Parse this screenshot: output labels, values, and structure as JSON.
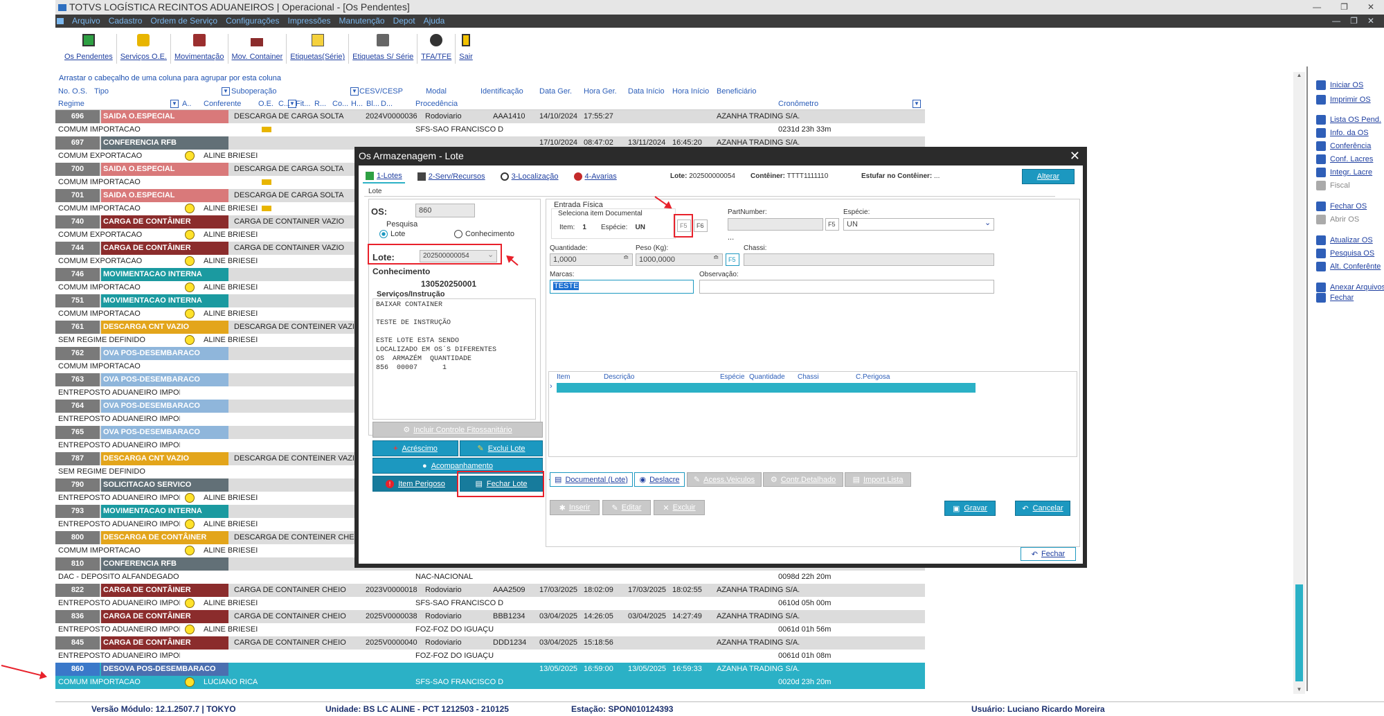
{
  "window": {
    "title": "TOTVS LOGÍSTICA RECINTOS ADUANEIROS | Operacional - [Os Pendentes]"
  },
  "menu": [
    "Arquivo",
    "Cadastro",
    "Ordem de Serviço",
    "Configurações",
    "Impressões",
    "Manutenção",
    "Depot",
    "Ajuda"
  ],
  "toolbar": [
    "Os Pendentes",
    "Serviços O.E.",
    "Movimentação",
    "Mov. Container",
    "Etiquetas(Série)",
    "Etiquetas S/ Série",
    "TFA/TFE",
    "Sair"
  ],
  "grid": {
    "group_hint": "Arrastar o cabeçalho de uma coluna para agrupar por esta coluna",
    "headers1": [
      "No. O.S.",
      "Tipo",
      "Suboperação",
      "CESV/CESP",
      "Modal",
      "Identificação",
      "Data Ger.",
      "Hora Ger.",
      "Data Início",
      "Hora Início",
      "Beneficiário"
    ],
    "headers2": [
      "Regime",
      "A..",
      "Conferente",
      "O.E.",
      "C...",
      "Fit...",
      "R...",
      "Co...",
      "H...",
      "Bl...",
      "D...",
      "Procedência",
      "Cronômetro"
    ],
    "rows": [
      {
        "num": "696",
        "tipo": "SAIDA O.ESPECIAL",
        "color": "#d9797a",
        "sub": "DESCARGA DE CARGA SOLTA",
        "cesv": "2024V0000036",
        "modal": "Rodoviario",
        "ident": "AAA1410",
        "dg": "14/10/2024",
        "hg": "17:55:27",
        "di": "",
        "hi": "",
        "benef": "AZANHA TRADING S/A.",
        "regime": "COMUM IMPORTACAO",
        "smile": false,
        "conf": "",
        "truck": true,
        "proc": "SFS-SAO FRANCISCO D",
        "crono": "0231d 23h 33m"
      },
      {
        "num": "697",
        "tipo": "CONFERENCIA RFB",
        "color": "#627077",
        "sub": "",
        "cesv": "",
        "modal": "",
        "ident": "",
        "dg": "17/10/2024",
        "hg": "08:47:02",
        "di": "13/11/2024",
        "hi": "16:45:20",
        "benef": "AZANHA TRADING S/A.",
        "regime": "COMUM EXPORTACAO",
        "smile": true,
        "conf": "ALINE BRIESEI",
        "truck": false,
        "proc": "",
        "crono": ""
      },
      {
        "num": "700",
        "tipo": "SAIDA O.ESPECIAL",
        "color": "#d9797a",
        "sub": "DESCARGA DE CARGA SOLTA",
        "cesv": "",
        "modal": "",
        "ident": "",
        "dg": "",
        "hg": "",
        "di": "",
        "hi": "",
        "benef": "",
        "regime": "COMUM IMPORTACAO",
        "smile": false,
        "conf": "",
        "truck": true,
        "proc": "",
        "crono": ""
      },
      {
        "num": "701",
        "tipo": "SAIDA O.ESPECIAL",
        "color": "#d9797a",
        "sub": "DESCARGA DE CARGA SOLTA",
        "cesv": "",
        "modal": "",
        "ident": "",
        "dg": "",
        "hg": "",
        "di": "",
        "hi": "",
        "benef": "",
        "regime": "COMUM IMPORTACAO",
        "smile": true,
        "conf": "ALINE BRIESEI",
        "truck": true,
        "proc": "",
        "crono": ""
      },
      {
        "num": "740",
        "tipo": "CARGA DE CONTÂINER",
        "color": "#8b2c2c",
        "sub": "CARGA DE CONTAINER VAZIO",
        "cesv": "",
        "modal": "",
        "ident": "",
        "dg": "",
        "hg": "",
        "di": "",
        "hi": "",
        "benef": "",
        "regime": "COMUM EXPORTACAO",
        "smile": true,
        "conf": "ALINE BRIESEI",
        "truck": false,
        "proc": "",
        "crono": ""
      },
      {
        "num": "744",
        "tipo": "CARGA DE CONTÂINER",
        "color": "#8b2c2c",
        "sub": "CARGA DE CONTAINER VAZIO",
        "cesv": "",
        "modal": "",
        "ident": "",
        "dg": "",
        "hg": "",
        "di": "",
        "hi": "",
        "benef": "",
        "regime": "COMUM EXPORTACAO",
        "smile": true,
        "conf": "ALINE BRIESEI",
        "truck": false,
        "proc": "",
        "crono": ""
      },
      {
        "num": "746",
        "tipo": "MOVIMENTACAO INTERNA",
        "color": "#1b9aa0",
        "sub": "",
        "cesv": "",
        "modal": "",
        "ident": "",
        "dg": "",
        "hg": "",
        "di": "",
        "hi": "",
        "benef": "",
        "regime": "COMUM IMPORTACAO",
        "smile": true,
        "conf": "ALINE BRIESEI",
        "truck": false,
        "proc": "",
        "crono": ""
      },
      {
        "num": "751",
        "tipo": "MOVIMENTACAO INTERNA",
        "color": "#1b9aa0",
        "sub": "",
        "cesv": "",
        "modal": "",
        "ident": "",
        "dg": "",
        "hg": "",
        "di": "",
        "hi": "",
        "benef": "",
        "regime": "COMUM IMPORTACAO",
        "smile": true,
        "conf": "ALINE BRIESEI",
        "truck": false,
        "proc": "",
        "crono": ""
      },
      {
        "num": "761",
        "tipo": "DESCARGA CNT VAZIO",
        "color": "#e3a51b",
        "sub": "DESCARGA DE CONTEINER VAZIO",
        "cesv": "",
        "modal": "",
        "ident": "",
        "dg": "",
        "hg": "",
        "di": "",
        "hi": "",
        "benef": "",
        "regime": "SEM REGIME DEFINIDO",
        "smile": true,
        "conf": "ALINE BRIESEI",
        "truck": false,
        "proc": "",
        "crono": ""
      },
      {
        "num": "762",
        "tipo": "OVA POS-DESEMBARACO",
        "color": "#8fb6db",
        "sub": "",
        "cesv": "",
        "modal": "",
        "ident": "",
        "dg": "",
        "hg": "",
        "di": "",
        "hi": "",
        "benef": "",
        "regime": "COMUM IMPORTACAO",
        "smile": false,
        "conf": "",
        "truck": false,
        "proc": "",
        "crono": ""
      },
      {
        "num": "763",
        "tipo": "OVA POS-DESEMBARACO",
        "color": "#8fb6db",
        "sub": "",
        "cesv": "",
        "modal": "",
        "ident": "",
        "dg": "",
        "hg": "",
        "di": "",
        "hi": "",
        "benef": "",
        "regime": "ENTREPOSTO ADUANEIRO IMPOF",
        "smile": false,
        "conf": "",
        "truck": false,
        "proc": "",
        "crono": ""
      },
      {
        "num": "764",
        "tipo": "OVA POS-DESEMBARACO",
        "color": "#8fb6db",
        "sub": "",
        "cesv": "",
        "modal": "",
        "ident": "",
        "dg": "",
        "hg": "",
        "di": "",
        "hi": "",
        "benef": "",
        "regime": "ENTREPOSTO ADUANEIRO IMPOF",
        "smile": false,
        "conf": "",
        "truck": false,
        "proc": "",
        "crono": ""
      },
      {
        "num": "765",
        "tipo": "OVA POS-DESEMBARACO",
        "color": "#8fb6db",
        "sub": "",
        "cesv": "",
        "modal": "",
        "ident": "",
        "dg": "",
        "hg": "",
        "di": "",
        "hi": "",
        "benef": "",
        "regime": "ENTREPOSTO ADUANEIRO IMPOF",
        "smile": false,
        "conf": "",
        "truck": false,
        "proc": "",
        "crono": ""
      },
      {
        "num": "787",
        "tipo": "DESCARGA CNT VAZIO",
        "color": "#e3a51b",
        "sub": "DESCARGA DE CONTEINER VAZIO",
        "cesv": "",
        "modal": "",
        "ident": "",
        "dg": "",
        "hg": "",
        "di": "",
        "hi": "",
        "benef": "",
        "regime": "SEM REGIME DEFINIDO",
        "smile": false,
        "conf": "",
        "truck": false,
        "proc": "",
        "crono": ""
      },
      {
        "num": "790",
        "tipo": "SOLICITACAO SERVICO",
        "color": "#627077",
        "sub": "",
        "cesv": "",
        "modal": "",
        "ident": "",
        "dg": "",
        "hg": "",
        "di": "",
        "hi": "",
        "benef": "",
        "regime": "ENTREPOSTO ADUANEIRO IMPOF",
        "smile": true,
        "conf": "ALINE BRIESEI",
        "truck": false,
        "proc": "",
        "crono": ""
      },
      {
        "num": "793",
        "tipo": "MOVIMENTACAO INTERNA",
        "color": "#1b9aa0",
        "sub": "",
        "cesv": "",
        "modal": "",
        "ident": "",
        "dg": "",
        "hg": "",
        "di": "",
        "hi": "",
        "benef": "",
        "regime": "ENTREPOSTO ADUANEIRO IMPOF",
        "smile": true,
        "conf": "ALINE BRIESEI",
        "truck": false,
        "proc": "",
        "crono": ""
      },
      {
        "num": "800",
        "tipo": "DESCARGA DE CONTÂINER",
        "color": "#e3a51b",
        "sub": "DESCARGA DE CONTEINER CHEI",
        "cesv": "",
        "modal": "",
        "ident": "",
        "dg": "",
        "hg": "",
        "di": "",
        "hi": "",
        "benef": "",
        "regime": "COMUM IMPORTACAO",
        "smile": true,
        "conf": "ALINE BRIESEI",
        "truck": false,
        "proc": "",
        "crono": ""
      },
      {
        "num": "810",
        "tipo": "CONFERENCIA RFB",
        "color": "#627077",
        "sub": "",
        "cesv": "",
        "modal": "",
        "ident": "",
        "dg": "",
        "hg": "",
        "di": "",
        "hi": "",
        "benef": "",
        "regime": "DAC - DEPOSITO ALFANDEGADO (",
        "smile": false,
        "conf": "",
        "truck": false,
        "proc": "NAC-NACIONAL",
        "crono": "0098d 22h 20m"
      },
      {
        "num": "822",
        "tipo": "CARGA DE CONTÂINER",
        "color": "#8b2c2c",
        "sub": "CARGA DE CONTAINER CHEIO",
        "cesv": "2023V0000018",
        "modal": "Rodoviario",
        "ident": "AAA2509",
        "dg": "17/03/2025",
        "hg": "18:02:09",
        "di": "17/03/2025",
        "hi": "18:02:55",
        "benef": "AZANHA TRADING S/A.",
        "regime": "ENTREPOSTO ADUANEIRO IMPOF",
        "smile": true,
        "conf": "ALINE BRIESEI",
        "truck": false,
        "proc": "SFS-SAO FRANCISCO D",
        "crono": "0610d 05h 00m"
      },
      {
        "num": "836",
        "tipo": "CARGA DE CONTÂINER",
        "color": "#8b2c2c",
        "sub": "CARGA DE CONTAINER CHEIO",
        "cesv": "2025V0000038",
        "modal": "Rodoviario",
        "ident": "BBB1234",
        "dg": "03/04/2025",
        "hg": "14:26:05",
        "di": "03/04/2025",
        "hi": "14:27:49",
        "benef": "AZANHA TRADING S/A.",
        "regime": "ENTREPOSTO ADUANEIRO IMPOF",
        "smile": true,
        "conf": "ALINE BRIESEI",
        "truck": false,
        "proc": "FOZ-FOZ DO IGUAÇU",
        "crono": "0061d 01h 56m"
      },
      {
        "num": "845",
        "tipo": "CARGA DE CONTÂINER",
        "color": "#8b2c2c",
        "sub": "CARGA DE CONTAINER CHEIO",
        "cesv": "2025V0000040",
        "modal": "Rodoviario",
        "ident": "DDD1234",
        "dg": "03/04/2025",
        "hg": "15:18:56",
        "di": "",
        "hi": "",
        "benef": "AZANHA TRADING S/A.",
        "regime": "ENTREPOSTO ADUANEIRO IMPOF",
        "smile": false,
        "conf": "",
        "truck": false,
        "proc": "FOZ-FOZ DO IGUAÇU",
        "crono": "0061d 01h 08m"
      },
      {
        "num": "860",
        "tipo": "DESOVA POS-DESEMBARACO",
        "color": "#4b6fb0",
        "sub": "",
        "cesv": "",
        "modal": "",
        "ident": "",
        "dg": "13/05/2025",
        "hg": "16:59:00",
        "di": "13/05/2025",
        "hi": "16:59:33",
        "benef": "AZANHA TRADING S/A.",
        "regime": "COMUM IMPORTACAO",
        "smile": true,
        "conf": "LUCIANO RICA",
        "truck": false,
        "proc": "SFS-SAO FRANCISCO D",
        "crono": "0020d 23h 20m",
        "selected": true
      }
    ]
  },
  "right_panel": [
    {
      "label": "Iniciar OS",
      "icon": "play-gear-icon",
      "enabled": true
    },
    {
      "label": "Imprimir OS",
      "icon": "printer-icon",
      "enabled": true
    },
    {
      "label": "Lista OS Pend.",
      "icon": "list-icon",
      "enabled": true
    },
    {
      "label": "Info. da OS",
      "icon": "info-icon",
      "enabled": true
    },
    {
      "label": "Conferência",
      "icon": "shield-check-icon",
      "enabled": true
    },
    {
      "label": "Conf. Lacres",
      "icon": "seal-icon",
      "enabled": true
    },
    {
      "label": "Integr. Lacre",
      "icon": "lock-icon",
      "enabled": true
    },
    {
      "label": "Fiscal",
      "icon": "fiscal-icon",
      "enabled": false
    },
    {
      "label": "Fechar OS",
      "icon": "close-os-icon",
      "enabled": true
    },
    {
      "label": "Abrir OS",
      "icon": "checkbox-icon",
      "enabled": false
    },
    {
      "label": "Atualizar OS",
      "icon": "refresh-icon",
      "enabled": true
    },
    {
      "label": "Pesquisa OS",
      "icon": "search-icon",
      "enabled": true
    },
    {
      "label": "Alt. Conferênte",
      "icon": "user-swap-icon",
      "enabled": true
    },
    {
      "label": "Anexar Arquivos",
      "icon": "paperclip-icon",
      "enabled": true
    },
    {
      "label": "Fechar",
      "icon": "back-arrow-icon",
      "enabled": true
    }
  ],
  "dialog": {
    "title": "Os Armazenagem - Lote",
    "tabs": [
      "1-Lotes",
      "2-Serv/Recursos",
      "3-Localização",
      "4-Avarias"
    ],
    "lote_label": "Lote:",
    "lote_value": "202500000054",
    "conteiner_label": "Contêiner:",
    "conteiner_value": "TTTT1111110",
    "estufar_label": "Estufar no Contêiner:",
    "estufar_value": "...",
    "alterar": "Alterar",
    "section_lote": "Lote",
    "os_label": "OS:",
    "os_value": "860",
    "pesquisa_label": "Pesquisa",
    "radio_lote": "Lote",
    "radio_conhecimento": "Conhecimento",
    "lote_field_label": "Lote:",
    "lote_field_value": "202500000054",
    "conhecimento_label": "Conhecimento",
    "conhecimento_value": "130520250001",
    "servicos_label": "Serviços/Instrução",
    "instrucao_lines": [
      "BAIXAR CONTAINER",
      "",
      "TESTE DE INSTRUÇÃO",
      "",
      "ESTE LOTE ESTA SENDO",
      "LOCALIZADO EM OS´S DIFERENTES",
      "OS  ARMAZÉM  QUANTIDADE",
      "856  00007      1"
    ],
    "btn_fitossanitario": "Incluir Controle Fitossanitário",
    "btn_acrescimo": "Acréscimo",
    "btn_exclui_lote": "Exclui Lote",
    "btn_acompanhamento": "Acompanhamento",
    "btn_item_perigoso": "Item Perigoso",
    "btn_fechar_lote": "Fechar Lote",
    "entrada_fisica": "Entrada Física",
    "seleciona_item": "Seleciona item Documental",
    "item_label": "Item:",
    "item_value": "1",
    "especie_label": "Espécie:",
    "especie_value": "UN",
    "f5": "F5",
    "f6": "F6",
    "partnumber_label": "PartNumber:",
    "especie2_label": "Espécie:",
    "especie2_value": "UN",
    "dots": "...",
    "quantidade_label": "Quantidade:",
    "quantidade_value": "1,0000",
    "peso_label": "Peso (Kg):",
    "peso_value": "1000,0000",
    "chassi_label": "Chassi:",
    "marcas_label": "Marcas:",
    "marcas_value": "TESTE",
    "observacao_label": "Observação:",
    "table_headers": [
      "Item",
      "Descrição",
      "Espécie",
      "Quantidade",
      "Chassi",
      "C.Perigosa"
    ],
    "subtabs": [
      "Documental (Lote)",
      "Deslacre",
      "Acess.Veiculos",
      "Contr.Detalhado",
      "Import.Lista"
    ],
    "btn_inserir": "Inserir",
    "btn_editar": "Editar",
    "btn_excluir": "Excluir",
    "btn_gravar": "Gravar",
    "btn_cancelar": "Cancelar",
    "btn_fechar": "Fechar"
  },
  "status": {
    "versao": "Versão Módulo:  12.1.2507.7  |  TOKYO",
    "unidade": "Unidade:  BS LC ALINE - PCT 1212503 - 210125",
    "estacao": "Estação:  SPON010124393",
    "usuario": "Usuário:  Luciano Ricardo Moreira"
  }
}
